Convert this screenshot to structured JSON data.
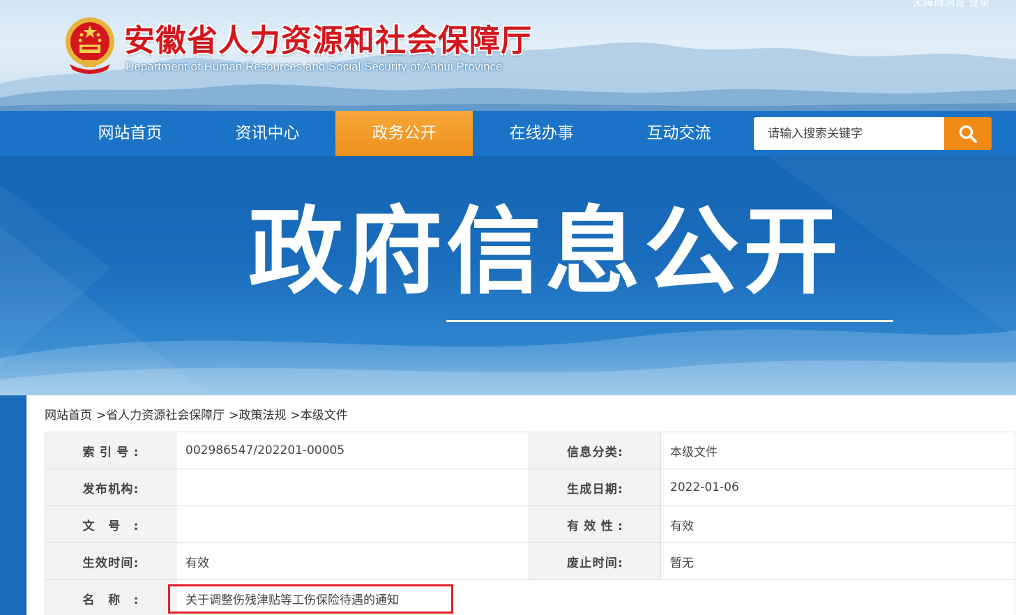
{
  "header": {
    "title_cn": "安徽省人力资源和社会保障厅",
    "title_en": "Department of Human Resources and Social Security of Anhui Province",
    "top_links": "无障碍浏览 登录"
  },
  "nav": {
    "items": [
      {
        "label": "网站首页",
        "active": false
      },
      {
        "label": "资讯中心",
        "active": false
      },
      {
        "label": "政务公开",
        "active": true
      },
      {
        "label": "在线办事",
        "active": false
      },
      {
        "label": "互动交流",
        "active": false
      }
    ],
    "search_placeholder": "请输入搜索关键字"
  },
  "banner": {
    "title": "政府信息公开"
  },
  "breadcrumb": [
    "网站首页",
    "省人力资源社会保障厅",
    "政策法规",
    "本级文件"
  ],
  "breadcrumb_sep": ">",
  "info_table": {
    "rows": [
      {
        "l1": "索引号:",
        "v1": "002986547/202201-00005",
        "l2": "信息分类:",
        "v2": "本级文件"
      },
      {
        "l1": "发布机构:",
        "v1": "",
        "l2": "生成日期:",
        "v2": "2022-01-06"
      },
      {
        "l1": "文号:",
        "v1": "",
        "l2": "有效性:",
        "v2": "有效"
      },
      {
        "l1": "生效时间:",
        "v1": "有效",
        "l2": "废止时间:",
        "v2": "暂无"
      },
      {
        "l1": "名称:",
        "v1": "关于调整伤残津贴等工伤保险待遇的通知"
      }
    ]
  },
  "colors": {
    "nav_bg": "#1a73c7",
    "nav_active": "#f19a2b",
    "title_red": "#d4161d",
    "highlight_red": "#e0202a"
  }
}
